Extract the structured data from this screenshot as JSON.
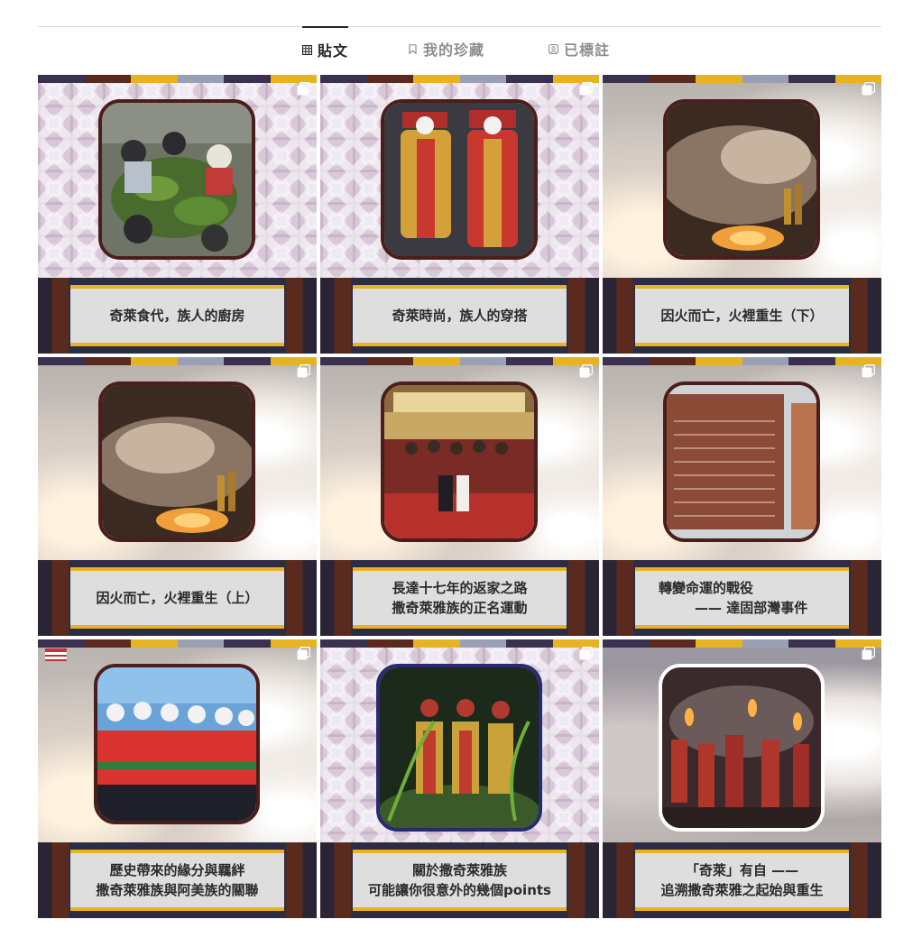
{
  "tabs": [
    {
      "label": "貼文",
      "icon": "grid-icon",
      "active": true
    },
    {
      "label": "我的珍藏",
      "icon": "bookmark-icon",
      "active": false
    },
    {
      "label": "已標註",
      "icon": "tagged-icon",
      "active": false
    }
  ],
  "posts": [
    {
      "lines": [
        "奇萊食代，族人的廚房"
      ],
      "photo": "cooking-photo",
      "bg": "pattern"
    },
    {
      "lines": [
        "奇萊時尚，族人的穿搭"
      ],
      "photo": "costume-photo",
      "bg": "pattern"
    },
    {
      "lines": [
        "因火而亡，火裡重生（下）"
      ],
      "photo": "fire-photo",
      "bg": "fire"
    },
    {
      "lines": [
        "因火而亡，火裡重生（上）"
      ],
      "photo": "fire-photo",
      "bg": "fire"
    },
    {
      "lines": [
        "長達十七年的返家之路",
        "撒奇萊雅族的正名運動"
      ],
      "photo": "ceremony-photo",
      "bg": "fire"
    },
    {
      "lines": [
        "轉變命運的戰役",
        "—— 達固部灣事件"
      ],
      "photo": "monument-photo",
      "bg": "fire"
    },
    {
      "lines": [
        "歷史帶來的緣分與羈絆",
        "撒奇萊雅族與阿美族的關聯"
      ],
      "photo": "dance-photo",
      "bg": "fire"
    },
    {
      "lines": [
        "關於撒奇萊雅族",
        "可能讓你很意外的幾個points"
      ],
      "photo": "performers-photo",
      "bg": "pattern"
    },
    {
      "lines": [
        "「奇萊」有自 ——",
        "追溯撒奇萊雅之起始與重生"
      ],
      "photo": "torch-ritual-photo",
      "bg": "fire2"
    }
  ],
  "colors": {
    "accent": "#e8b320",
    "frame": "#4a1e1c",
    "navy": "#2c2c45",
    "active_tab": "#262626",
    "inactive_tab": "#8e8e8e"
  }
}
